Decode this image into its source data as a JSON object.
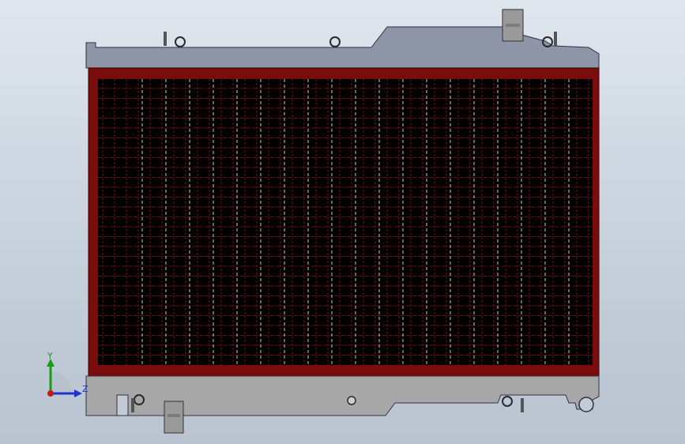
{
  "viewport": {
    "background_top": "#dfe6ee",
    "background_bottom": "#b9c4d0"
  },
  "model": {
    "tank_color": "#8e95a6",
    "tank_stroke": "#2f3340",
    "core_frame_color": "#7a0c0c",
    "core_fill": "#000000",
    "fin_line_color": "#c42020",
    "tube_line_color": "#ffffff",
    "lower_tank_color": "#a7a7a7",
    "pipe_color": "#9a9a9a"
  },
  "triad": {
    "y_label": "Y",
    "z_label": "Z",
    "y_color": "#1a9a1a",
    "z_color": "#1f35c8",
    "x_color": "#c41a1a"
  }
}
